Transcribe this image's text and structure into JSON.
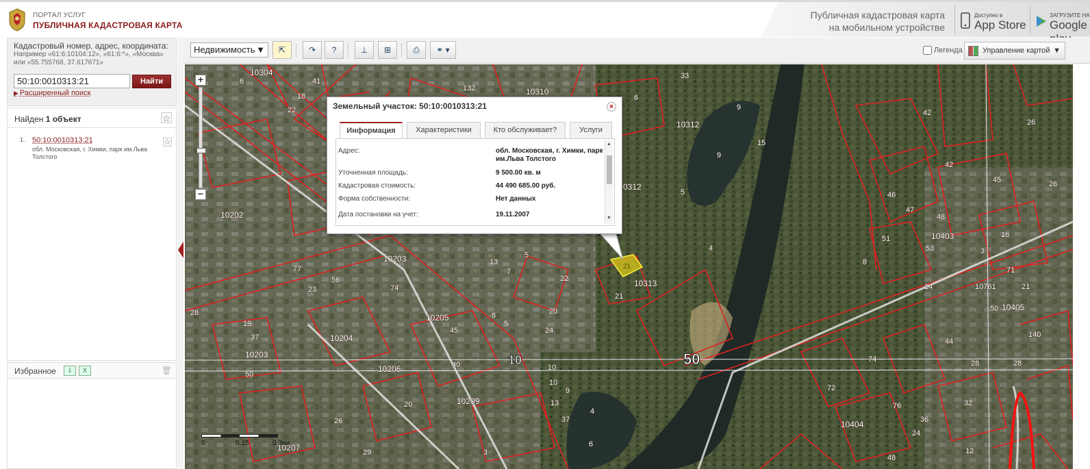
{
  "header": {
    "portal_small": "ПОРТАЛ УСЛУГ",
    "portal_title": "ПУБЛИЧНАЯ КАДАСТРОВАЯ КАРТА",
    "promo_line1": "Публичная кадастровая карта",
    "promo_line2": "на мобильном устройстве",
    "appstore_small": "Доступно в",
    "appstore_big": "App Store",
    "googleplay_small": "ЗАГРУЗИТЕ НА",
    "googleplay_big": "Google play"
  },
  "search": {
    "title": "Кадастровый номер, адрес, координата:",
    "hint": "Например «61:6:10104:12», «61:6:*», «Москва» или «55.755768, 37.617671»",
    "value": "50:10:0010313:21",
    "button": "Найти",
    "advanced": "Расширенный поиск"
  },
  "results": {
    "found_prefix": "Найден",
    "found_count": "1 объект",
    "items": [
      {
        "num": "1.",
        "id": "50:10:0010313:21",
        "address": "обл. Московская, г. Химки, парк им.Льва Толстого"
      }
    ]
  },
  "favorites": {
    "label": "Избранное"
  },
  "toolbar": {
    "layer": "Недвижимость",
    "legend": "Легенда",
    "map_control": "Управление картой"
  },
  "popup": {
    "title": "Земельный участок: 50:10:0010313:21",
    "tabs": [
      "Информация",
      "Характеристики",
      "Кто обслуживает?",
      "Услуги"
    ],
    "rows": [
      {
        "key": "Адрес:",
        "value": "обл. Московская, г. Химки, парк им.Льва Толстого"
      },
      {
        "key": "Уточненная площадь:",
        "value": "9 500.00 кв. м"
      },
      {
        "key": "Кадастровая стоимость:",
        "value": "44 490 685.00 руб."
      },
      {
        "key": "Форма собственности:",
        "value": "Нет данных"
      },
      {
        "key": "Дата постановки на учет:",
        "value": "19.11.2007"
      }
    ]
  },
  "scale": {
    "labels": [
      "0",
      "0.15",
      "0.3км"
    ]
  },
  "map_labels": {
    "quarters": [
      "10304",
      "10310",
      "10312",
      "10202",
      "10203",
      "10205",
      "10204",
      "10206",
      "10209",
      "10207",
      "10203",
      "10313",
      "10403",
      "10405",
      "10404",
      "0312"
    ],
    "parcels": [
      "6",
      "41",
      "18",
      "22",
      "132",
      "33",
      "9",
      "6",
      "15",
      "9",
      "5",
      "42",
      "26",
      "45",
      "46",
      "42",
      "47",
      "48",
      "16",
      "4",
      "8",
      "51",
      "53",
      "3",
      "5",
      "7",
      "23",
      "77",
      "56",
      "20",
      "74",
      "13",
      "8",
      "5",
      "22",
      "21",
      "28",
      "19",
      "50",
      "37",
      "45",
      "40",
      "24",
      "6",
      "20",
      "10",
      "10",
      "13",
      "9",
      "26",
      "4",
      "37",
      "3",
      "29",
      "14",
      "50",
      "72",
      "74",
      "48",
      "76",
      "44",
      "28",
      "24",
      "36",
      "32",
      "71",
      "21",
      "28",
      "12",
      "10761",
      "140",
      "26"
    ],
    "big_numbers": [
      "50",
      "10"
    ]
  },
  "colors": {
    "accent": "#8a1c1c",
    "parcel_line": "#e02020",
    "selected_parcel": "#d8c81a"
  }
}
